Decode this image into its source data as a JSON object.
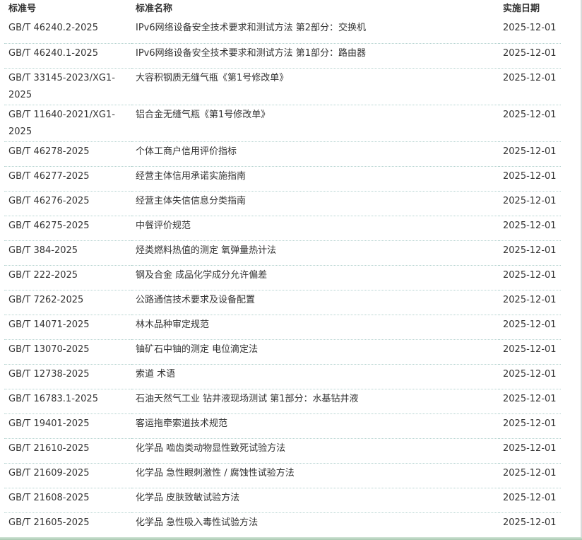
{
  "columns": {
    "code": "标准号",
    "name": "标准名称",
    "date": "实施日期"
  },
  "rows": [
    {
      "code": "GB/T 46240.2-2025",
      "name": "IPv6网络设备安全技术要求和测试方法 第2部分：交换机",
      "date": "2025-12-01"
    },
    {
      "code": "GB/T 46240.1-2025",
      "name": "IPv6网络设备安全技术要求和测试方法 第1部分：路由器",
      "date": "2025-12-01"
    },
    {
      "code": "GB/T 33145-2023/XG1-2025",
      "name": "大容积钢质无缝气瓶《第1号修改单》",
      "date": "2025-12-01"
    },
    {
      "code": "GB/T 11640-2021/XG1-2025",
      "name": "铝合金无缝气瓶《第1号修改单》",
      "date": "2025-12-01"
    },
    {
      "code": "GB/T 46278-2025",
      "name": "个体工商户信用评价指标",
      "date": "2025-12-01"
    },
    {
      "code": "GB/T 46277-2025",
      "name": "经营主体信用承诺实施指南",
      "date": "2025-12-01"
    },
    {
      "code": "GB/T 46276-2025",
      "name": "经营主体失信信息分类指南",
      "date": "2025-12-01"
    },
    {
      "code": "GB/T 46275-2025",
      "name": "中餐评价规范",
      "date": "2025-12-01"
    },
    {
      "code": "GB/T 384-2025",
      "name": "烃类燃料热值的测定 氧弹量热计法",
      "date": "2025-12-01"
    },
    {
      "code": "GB/T 222-2025",
      "name": "钢及合金 成品化学成分允许偏差",
      "date": "2025-12-01"
    },
    {
      "code": "GB/T 7262-2025",
      "name": "公路通信技术要求及设备配置",
      "date": "2025-12-01"
    },
    {
      "code": "GB/T 14071-2025",
      "name": "林木品种审定规范",
      "date": "2025-12-01"
    },
    {
      "code": "GB/T 13070-2025",
      "name": "铀矿石中铀的测定 电位滴定法",
      "date": "2025-12-01"
    },
    {
      "code": "GB/T 12738-2025",
      "name": "索道 术语",
      "date": "2025-12-01"
    },
    {
      "code": "GB/T 16783.1-2025",
      "name": "石油天然气工业 钻井液现场测试 第1部分：水基钻井液",
      "date": "2025-12-01"
    },
    {
      "code": "GB/T 19401-2025",
      "name": "客运拖牵索道技术规范",
      "date": "2025-12-01"
    },
    {
      "code": "GB/T 21610-2025",
      "name": "化学品 啮齿类动物显性致死试验方法",
      "date": "2025-12-01"
    },
    {
      "code": "GB/T 21609-2025",
      "name": "化学品 急性眼刺激性 / 腐蚀性试验方法",
      "date": "2025-12-01"
    },
    {
      "code": "GB/T 21608-2025",
      "name": "化学品 皮肤致敏试验方法",
      "date": "2025-12-01"
    },
    {
      "code": "GB/T 21605-2025",
      "name": "化学品 急性吸入毒性试验方法",
      "date": "2025-12-01"
    }
  ]
}
